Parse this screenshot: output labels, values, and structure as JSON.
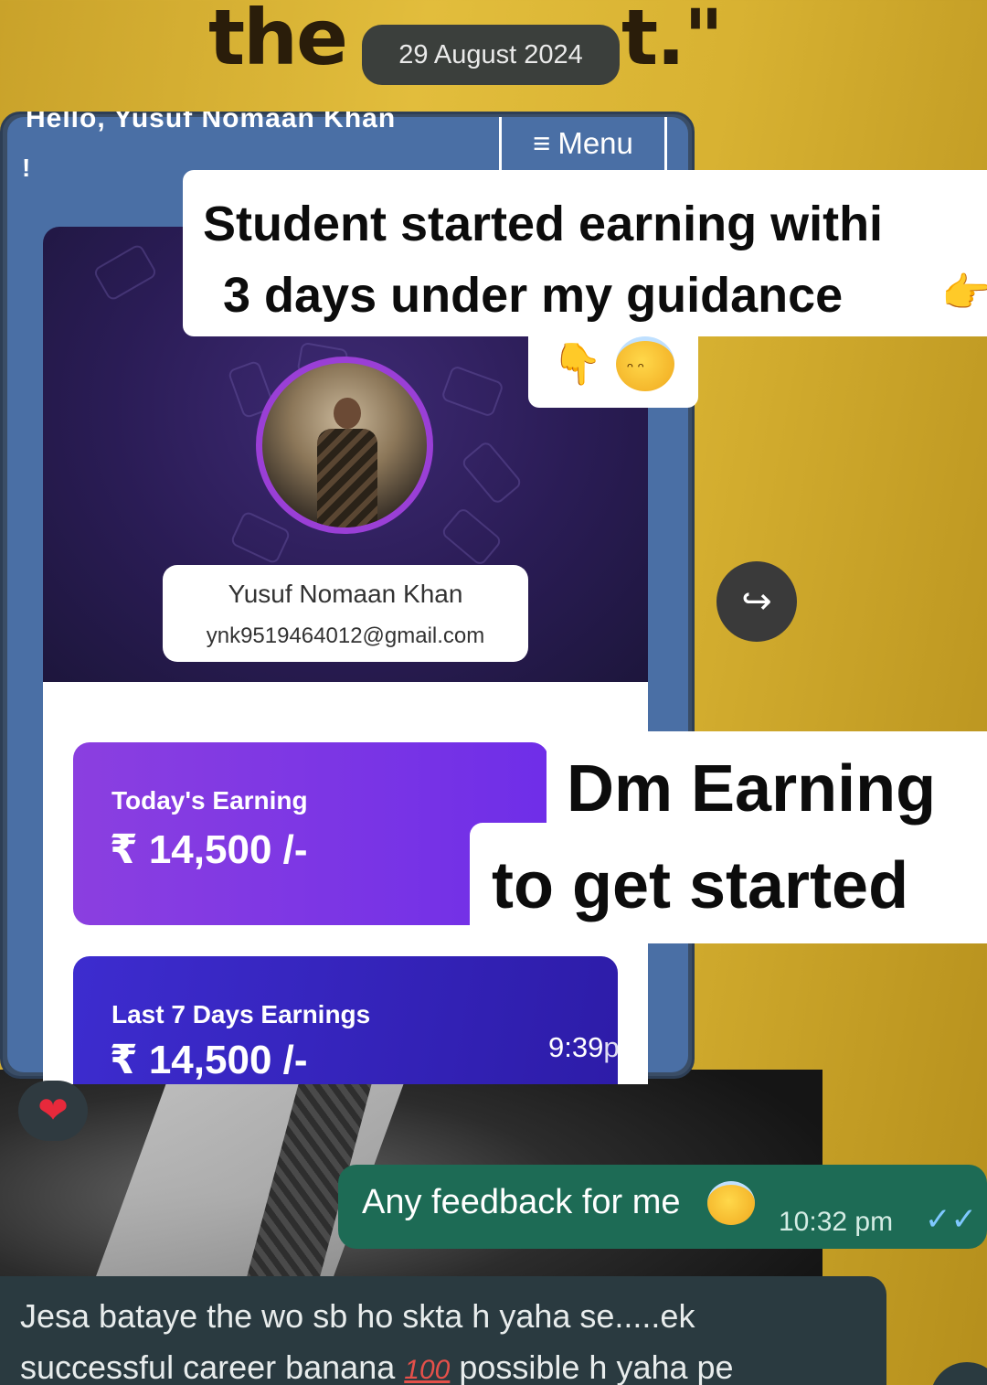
{
  "background": {
    "top_text_left": "the",
    "top_text_right": "t.\""
  },
  "date_chip": "29 August 2024",
  "website": {
    "greeting": "Hello, Yusuf Nomaan Khan",
    "greeting_excl": "!",
    "menu_icon": "≡",
    "menu_label": "Menu",
    "profile": {
      "name": "Yusuf Nomaan Khan",
      "email": "ynk9519464012@gmail.com"
    },
    "today_earning": {
      "label": "Today's Earning",
      "value": "₹ 14,500 /-"
    },
    "last7_earning": {
      "label": "Last 7 Days Earnings",
      "value": "₹ 14,500 /-"
    }
  },
  "forwarded_message": {
    "time": "9:39",
    "time_suffix": "pm"
  },
  "overlay_caption_1": {
    "line1": "Student started earning withi",
    "line2": "3 days under my guidance",
    "emoji_pointer": "👉",
    "emoji_down": "👇"
  },
  "overlay_caption_2": {
    "line1": "Dm Earning",
    "line2": "to get started"
  },
  "forward_icon_glyph": "↪",
  "reaction": "❤",
  "outgoing_message": {
    "text": "Any feedback for me",
    "time": "10:32 pm",
    "ticks": "✓✓"
  },
  "incoming_message": {
    "line1": "Jesa bataye the wo sb ho skta h yaha se.....ek",
    "line2_a": "successful career banana",
    "line2_emoji": "100",
    "line2_b": "possible h yaha pe"
  }
}
